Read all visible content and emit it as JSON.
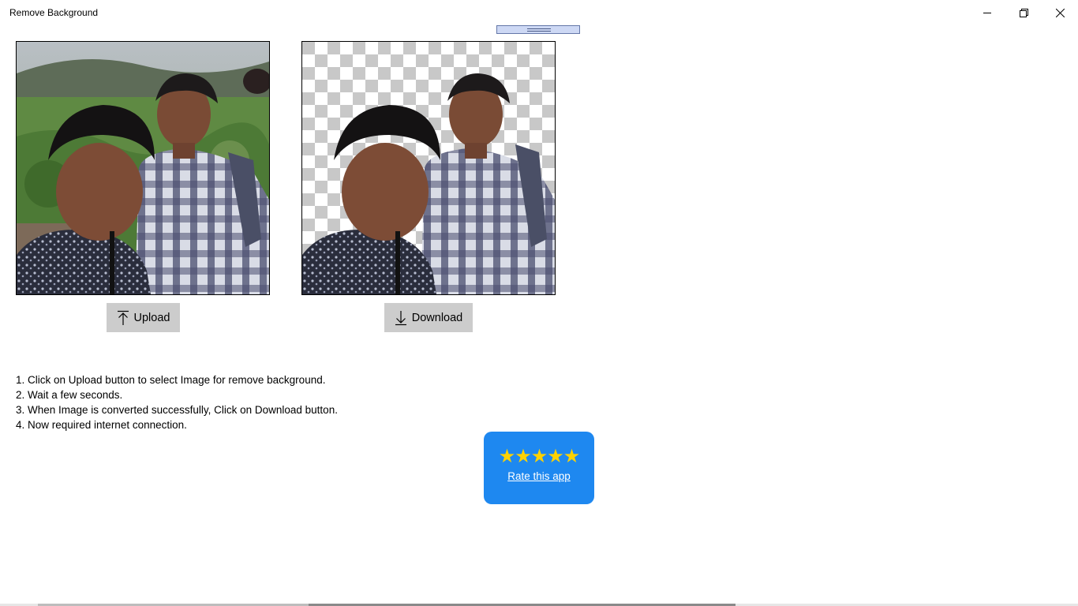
{
  "window": {
    "title": "Remove Background",
    "minimize_icon": "minimize-icon",
    "restore_icon": "restore-icon",
    "close_icon": "close-icon"
  },
  "images": {
    "original_icon": "photo-original",
    "result_icon": "photo-background-removed"
  },
  "buttons": {
    "upload_label": "Upload",
    "upload_icon": "upload-arrow-icon",
    "download_label": "Download",
    "download_icon": "download-arrow-icon"
  },
  "instructions": [
    "1. Click on Upload button to select Image for remove background.",
    "2. Wait a few seconds.",
    "3. When Image is converted successfully, Click on Download button.",
    "4. Now required internet connection."
  ],
  "rate": {
    "stars": "★★★★★",
    "label": "Rate this app",
    "star_color": "#ffd200",
    "background": "#1e88f0"
  }
}
